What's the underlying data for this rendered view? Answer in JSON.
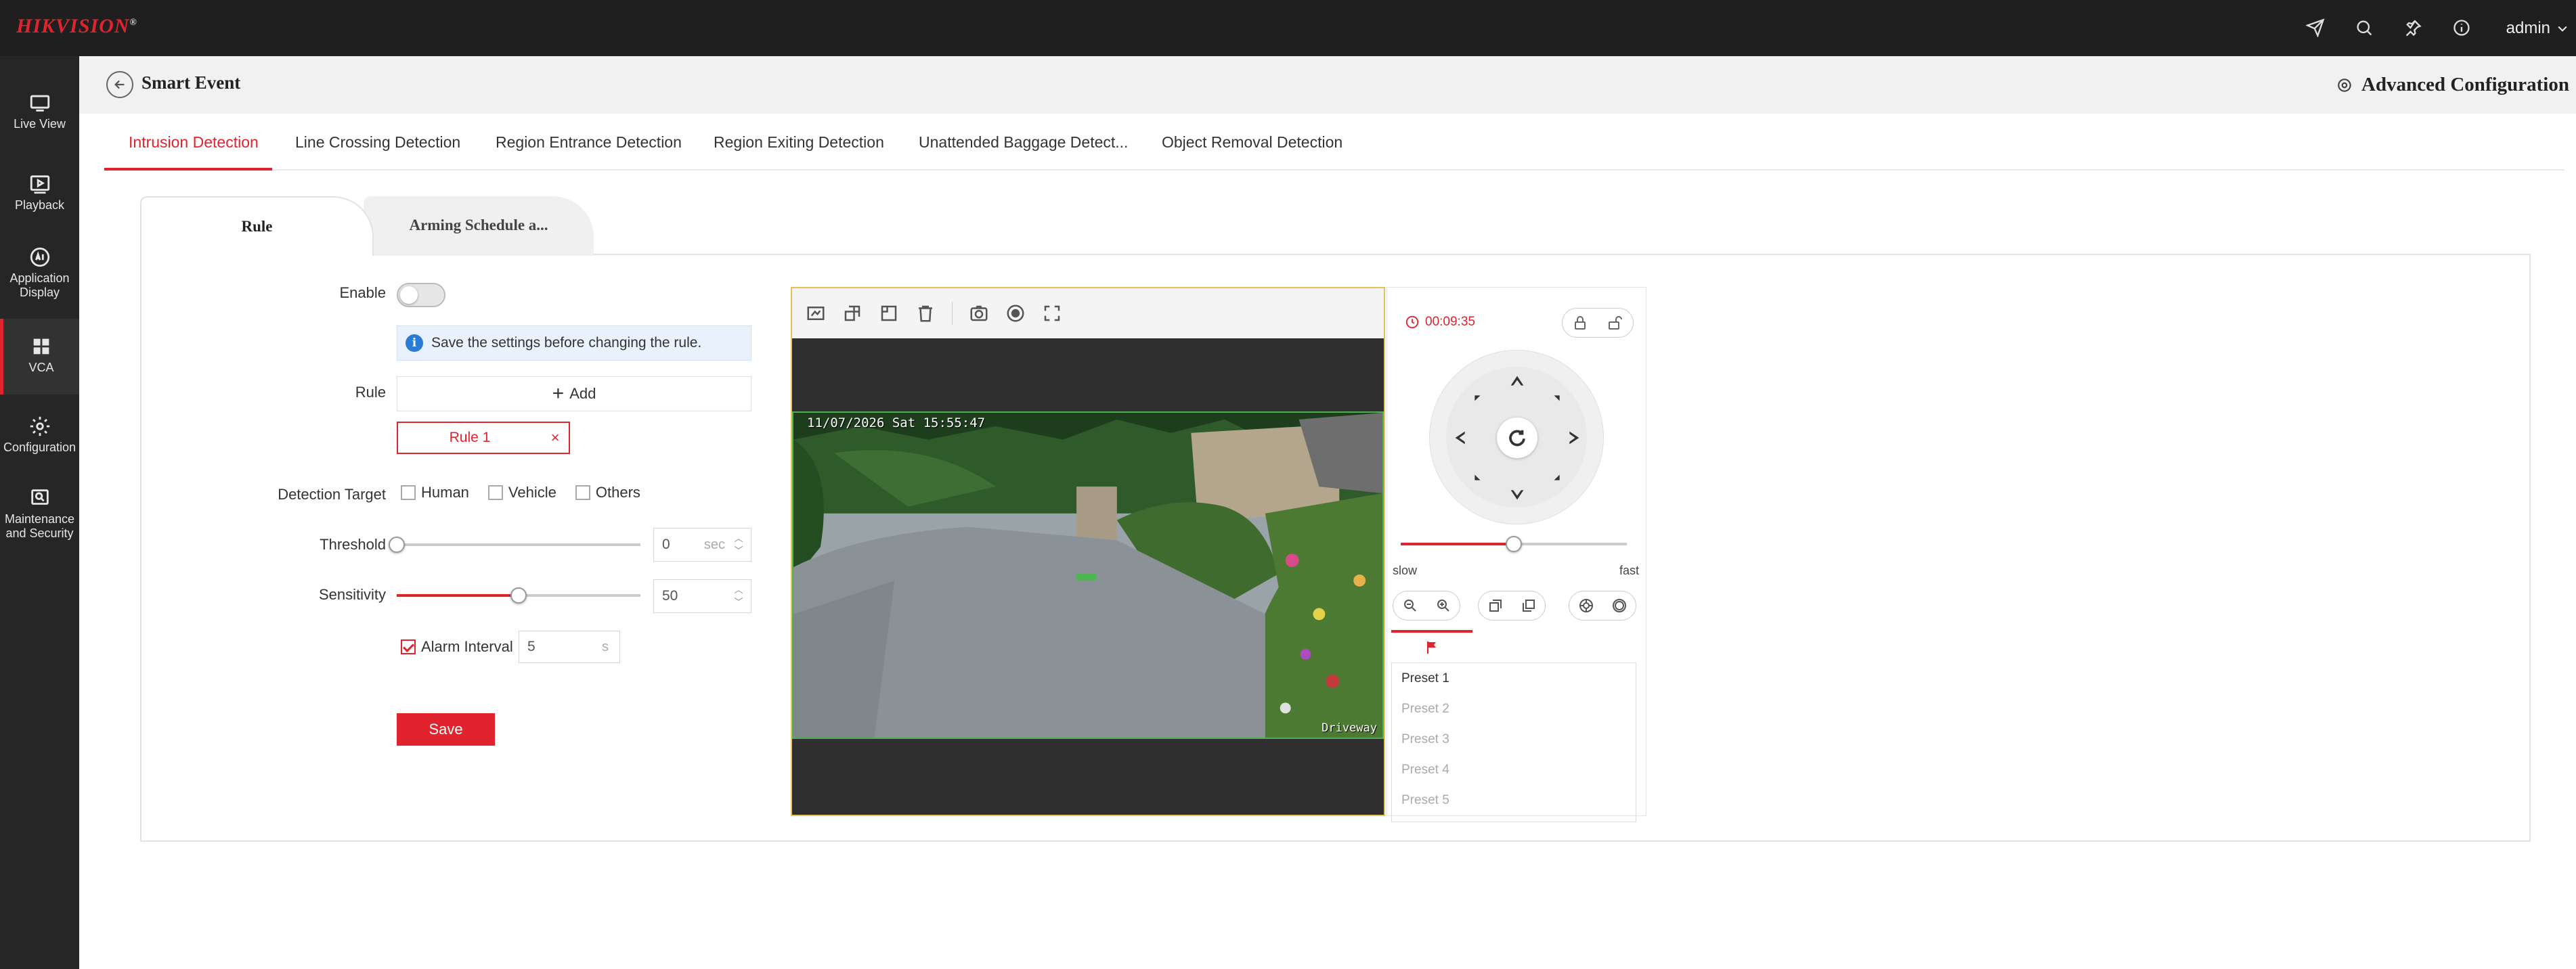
{
  "brand": {
    "name": "HIKVISION",
    "mark": "®"
  },
  "topbar": {
    "icons": [
      "send-icon",
      "search-icon",
      "pin-icon",
      "info-icon"
    ],
    "user": "admin"
  },
  "sidebar": {
    "items": [
      {
        "label": "Live View",
        "icon": "monitor-icon"
      },
      {
        "label": "Playback",
        "icon": "play-icon"
      },
      {
        "label": "Application Display",
        "icon": "ai-icon"
      },
      {
        "label": "VCA",
        "icon": "grid-icon",
        "active": true
      },
      {
        "label": "Configuration",
        "icon": "gear-icon"
      },
      {
        "label": "Maintenance and Security",
        "icon": "shield-icon"
      }
    ]
  },
  "header": {
    "title": "Smart Event",
    "advanced": "Advanced Configuration"
  },
  "tabs": [
    {
      "label": "Intrusion Detection",
      "active": true
    },
    {
      "label": "Line Crossing Detection"
    },
    {
      "label": "Region Entrance Detection"
    },
    {
      "label": "Region Exiting Detection"
    },
    {
      "label": "Unattended Baggage Detect..."
    },
    {
      "label": "Object Removal Detection"
    }
  ],
  "subtabs": {
    "rule": "Rule",
    "schedule": "Arming Schedule a..."
  },
  "form": {
    "enable_label": "Enable",
    "enabled": false,
    "info": "Save the settings before changing the rule.",
    "rule_label": "Rule",
    "add_label": "Add",
    "rule_chip": "Rule 1",
    "detection_target_label": "Detection Target",
    "targets": [
      {
        "label": "Human",
        "checked": false
      },
      {
        "label": "Vehicle",
        "checked": false
      },
      {
        "label": "Others",
        "checked": false
      }
    ],
    "threshold_label": "Threshold",
    "threshold_value": "0",
    "threshold_unit": "sec",
    "threshold_fraction": 0.0,
    "sensitivity_label": "Sensitivity",
    "sensitivity_value": "50",
    "sensitivity_fraction": 0.5,
    "alarm_interval_label": "Alarm Interval",
    "alarm_interval_checked": true,
    "alarm_interval_value": "5",
    "alarm_interval_unit": "s",
    "save_label": "Save"
  },
  "video": {
    "toolbar_icons": [
      "draw-area-icon",
      "max-size-icon",
      "min-size-icon",
      "delete-icon",
      "capture-icon",
      "record-icon",
      "fullscreen-icon"
    ],
    "osd_time": "11/07/2026 Sat 15:55:47",
    "osd_camera": "Driveway"
  },
  "ptz": {
    "timer": "00:09:35",
    "speed_fraction": 0.5,
    "slow_label": "slow",
    "fast_label": "fast",
    "presets": [
      "Preset 1",
      "Preset 2",
      "Preset 3",
      "Preset 4",
      "Preset 5"
    ]
  },
  "colors": {
    "accent": "#e0232e",
    "topbar": "#1f1f1f",
    "sidebar": "#262626",
    "info": "#2a7bd4"
  }
}
